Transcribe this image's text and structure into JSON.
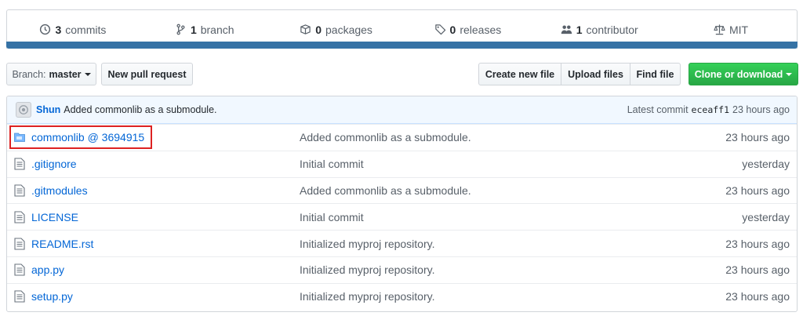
{
  "summary": {
    "commits": {
      "num": "3",
      "label": "commits",
      "icon": "history-icon"
    },
    "branches": {
      "num": "1",
      "label": "branch",
      "icon": "branch-icon"
    },
    "packages": {
      "num": "0",
      "label": "packages",
      "icon": "package-icon"
    },
    "releases": {
      "num": "0",
      "label": "releases",
      "icon": "tag-icon"
    },
    "contributors": {
      "num": "1",
      "label": "contributor",
      "icon": "people-icon"
    },
    "license": {
      "label": "MIT",
      "icon": "law-icon"
    },
    "language_color": "#3572a5"
  },
  "toolbar": {
    "branch_prefix": "Branch:",
    "branch_name": "master",
    "new_pull_request": "New pull request",
    "create_new_file": "Create new file",
    "upload_files": "Upload files",
    "find_file": "Find file",
    "clone_or_download": "Clone or download"
  },
  "latest_commit": {
    "author": "Shun",
    "message": "Added commonlib as a submodule.",
    "label": "Latest commit",
    "sha": "eceaff1",
    "age": "23 hours ago"
  },
  "files": [
    {
      "name": "commonlib @ 3694915",
      "type": "submodule",
      "message": "Added commonlib as a submodule.",
      "age": "23 hours ago",
      "highlighted": true
    },
    {
      "name": ".gitignore",
      "type": "file",
      "message": "Initial commit",
      "age": "yesterday"
    },
    {
      "name": ".gitmodules",
      "type": "file",
      "message": "Added commonlib as a submodule.",
      "age": "23 hours ago"
    },
    {
      "name": "LICENSE",
      "type": "file",
      "message": "Initial commit",
      "age": "yesterday"
    },
    {
      "name": "README.rst",
      "type": "file",
      "message": "Initialized myproj repository.",
      "age": "23 hours ago"
    },
    {
      "name": "app.py",
      "type": "file",
      "message": "Initialized myproj repository.",
      "age": "23 hours ago"
    },
    {
      "name": "setup.py",
      "type": "file",
      "message": "Initialized myproj repository.",
      "age": "23 hours ago"
    }
  ],
  "colors": {
    "link": "#0366d6",
    "green_button": "#28a745",
    "highlight_box": "#dd2222"
  }
}
